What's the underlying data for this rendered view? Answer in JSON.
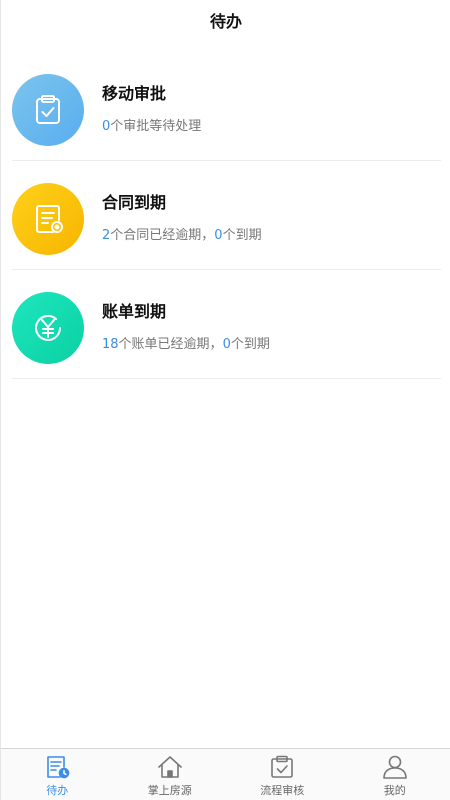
{
  "header": {
    "title": "待办"
  },
  "items": [
    {
      "title": "移动审批",
      "sub": [
        {
          "num": "0"
        },
        {
          "text": "个审批等待处理"
        }
      ]
    },
    {
      "title": "合同到期",
      "sub": [
        {
          "num": "2"
        },
        {
          "text": "个合同已经逾期，"
        },
        {
          "num": "0"
        },
        {
          "text": "个到期"
        }
      ]
    },
    {
      "title": "账单到期",
      "sub": [
        {
          "num": "18"
        },
        {
          "text": "个账单已经逾期，"
        },
        {
          "num": "0"
        },
        {
          "text": "个到期"
        }
      ]
    }
  ],
  "tabs": [
    {
      "label": "待办",
      "icon": "todo-icon",
      "active": true
    },
    {
      "label": "掌上房源",
      "icon": "house-icon",
      "active": false
    },
    {
      "label": "流程审核",
      "icon": "clipboard-check-icon",
      "active": false
    },
    {
      "label": "我的",
      "icon": "user-icon",
      "active": false
    }
  ],
  "colors": {
    "accent": "#3a8ee6",
    "approval_gradient": [
      "#7cc4ec",
      "#58aef0"
    ],
    "contract_gradient": [
      "#ffd11a",
      "#f7b500"
    ],
    "bill_gradient": [
      "#1ee6be",
      "#0bd0a3"
    ]
  },
  "icons": {
    "approval": "clipboard-check-icon",
    "contract": "document-seal-icon",
    "bill": "yen-circle-icon"
  }
}
